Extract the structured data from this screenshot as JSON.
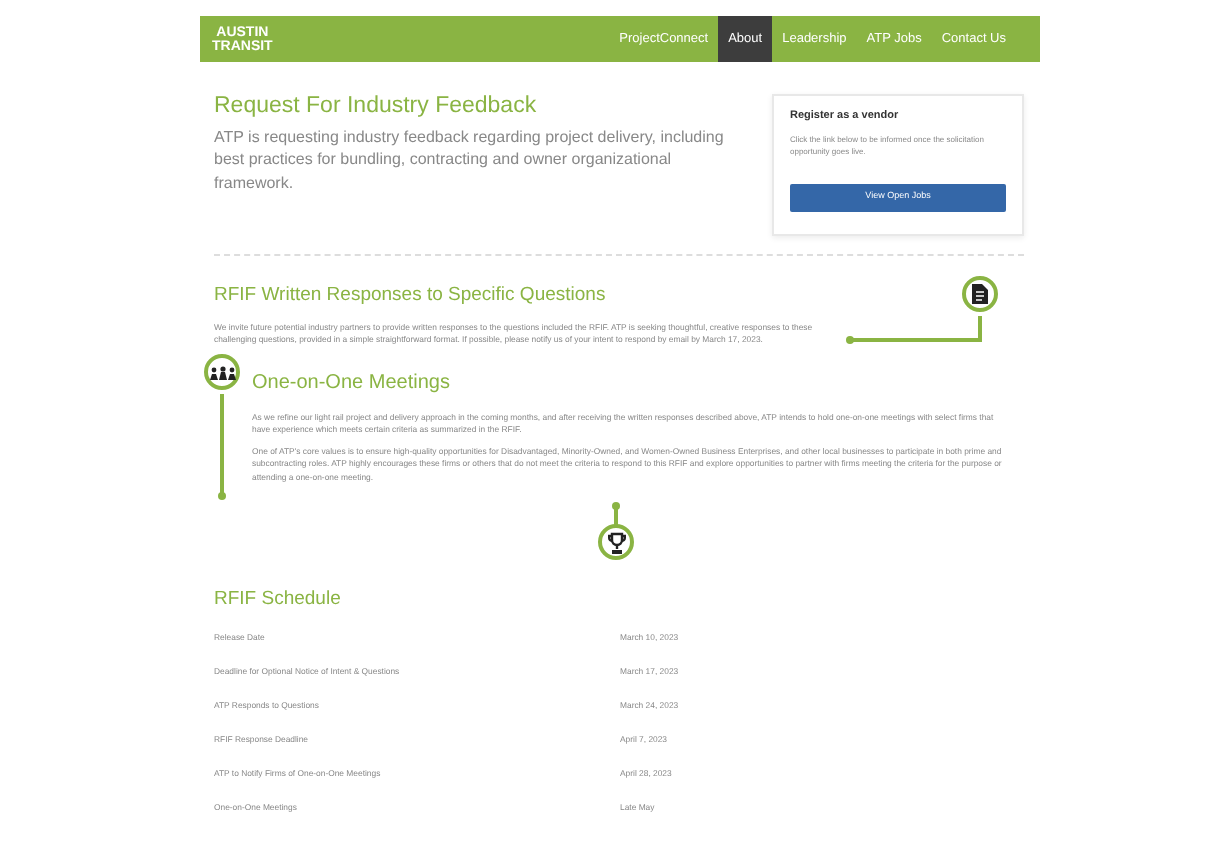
{
  "logo": {
    "line_1": "AUSTIN",
    "line_2": "TRANSIT"
  },
  "nav": [
    {
      "label": "ProjectConnect",
      "selected": false
    },
    {
      "label": "About",
      "selected": true
    },
    {
      "label": "Leadership",
      "selected": false
    },
    {
      "label": "ATP Jobs",
      "selected": false
    },
    {
      "label": "Contact Us",
      "selected": false
    }
  ],
  "intro": {
    "title": "Request For Industry Feedback",
    "text": "ATP is requesting industry feedback regarding project delivery, including best practices for bundling, contracting and owner organizational framework."
  },
  "vendor_card": {
    "title": "Register as a vendor",
    "text": "Click the link below to be informed once the solicitation opportunity goes live.",
    "button": "View Open Jobs"
  },
  "sections": [
    {
      "title": "RFIF Written Responses to Specific Questions",
      "paragraphs": [
        "We invite future potential industry partners to provide written responses to the questions included the RFIF. ATP is seeking thoughtful, creative responses to these challenging questions, provided in a simple straightforward format. If possible, please notify us of your intent to respond by email by March 17, 2023."
      ]
    },
    {
      "title": "One-on-One Meetings",
      "paragraphs": [
        "As we refine our light rail project and delivery approach in the coming months, and after receiving the written responses described above, ATP intends to hold one-on-one meetings with select firms that have experience which meets certain criteria as summarized in the RFIF.",
        "One of ATP's core values is to ensure high-quality opportunities for Disadvantaged, Minority-Owned, and Women-Owned Business Enterprises, and other local businesses to participate in both prime and subcontracting roles. ATP highly encourages these firms or others that do not meet the criteria to respond to this RFIF and explore opportunities to partner with firms meeting the criteria for the purpose or attending a one-on-one meeting."
      ]
    }
  ],
  "schedule": {
    "title": "RFIF Schedule",
    "rows": [
      {
        "event": "Release Date",
        "date": "March 10, 2023"
      },
      {
        "event": "Deadline for Optional Notice of Intent & Questions",
        "date": "March 17, 2023"
      },
      {
        "event": "ATP Responds to Questions",
        "date": "March 24, 2023"
      },
      {
        "event": "RFIF Response Deadline",
        "date": "April 7, 2023"
      },
      {
        "event": "ATP to Notify Firms of One-on-One Meetings",
        "date": "April 28, 2023"
      },
      {
        "event": "One-on-One Meetings",
        "date": "Late May"
      }
    ]
  }
}
